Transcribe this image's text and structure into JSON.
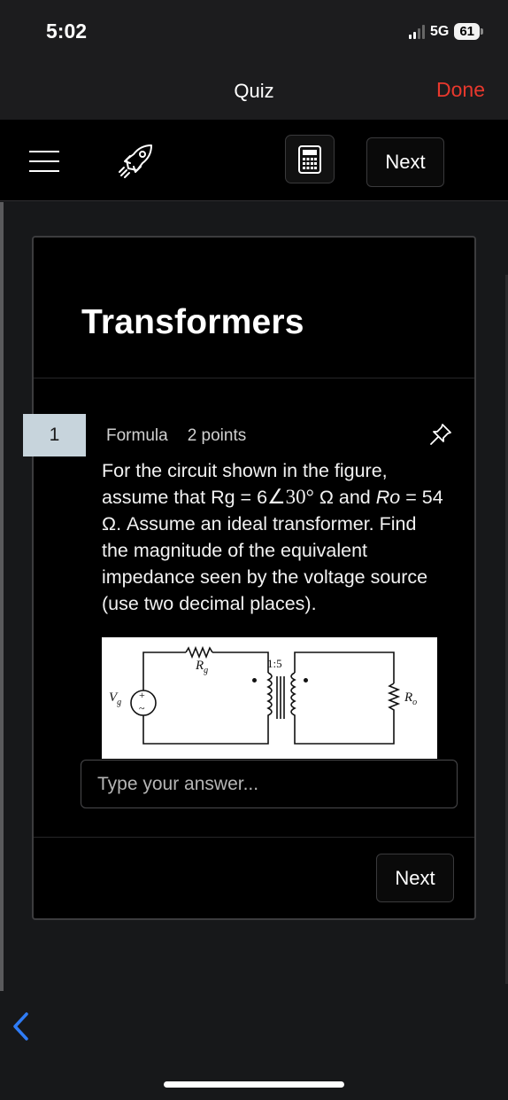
{
  "status_bar": {
    "time": "5:02",
    "network": "5G",
    "battery": "61"
  },
  "header": {
    "title": "Quiz",
    "done_label": "Done"
  },
  "toolbar": {
    "menu_icon": "hamburger-menu-icon",
    "rocket_icon": "rocket-icon",
    "calculator_icon": "calculator-icon",
    "next_label": "Next"
  },
  "quiz": {
    "title": "Transformers",
    "question_number": "1",
    "question_type": "Formula",
    "points": "2 points",
    "question_text": {
      "part1": "For the circuit shown in the figure, assume that Rg = 6",
      "angle": "∠30°",
      "part2": " Ω and ",
      "ro_italic": "Ro",
      "part3": " = 54 Ω. Assume an ideal transformer. Find the magnitude of the equivalent impedance seen by the voltage source (use two decimal places)."
    },
    "figure": {
      "source_label": "V",
      "rg_label": "R",
      "rg_sub": "g",
      "ratio_label": "1:5",
      "ro_label": "R",
      "ro_sub": "o"
    },
    "answer_placeholder": "Type your answer...",
    "next_label": "Next"
  },
  "colors": {
    "accent_done": "#e8382d",
    "question_badge_bg": "#c7d4dc",
    "back_chevron": "#2f7cf6"
  }
}
